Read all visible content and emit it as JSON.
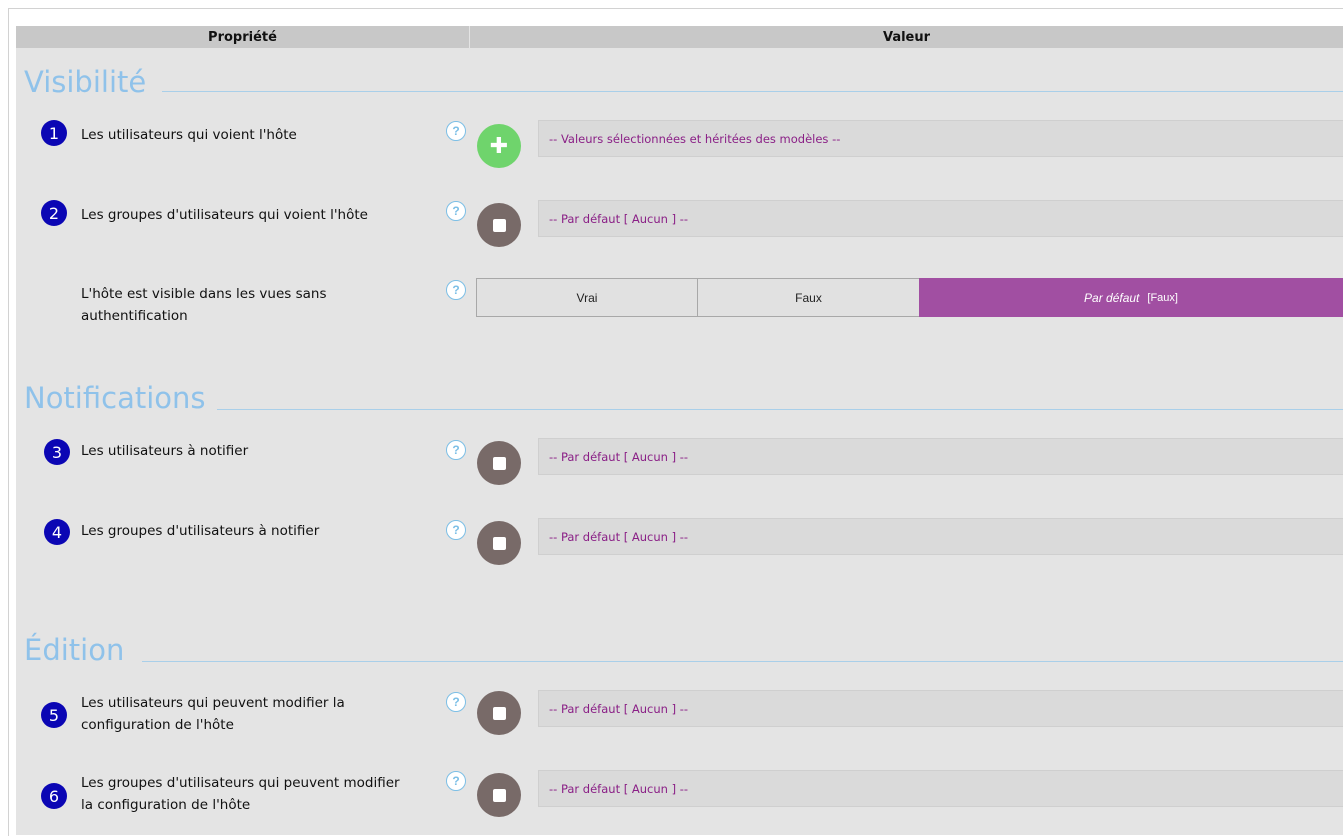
{
  "header": {
    "property_label": "Propriété",
    "value_label": "Valeur"
  },
  "sections": {
    "visibility": "Visibilité",
    "notifications": "Notifications",
    "edition": "Édition"
  },
  "help_glyph": "?",
  "rows": {
    "r1": {
      "number": "1",
      "label": "Les utilisateurs qui voient l'hôte",
      "value": "-- Valeurs sélectionnées et héritées des modèles --"
    },
    "r2": {
      "number": "2",
      "label": "Les groupes d'utilisateurs qui voient l'hôte",
      "value": "-- Par défaut [ Aucun ] --"
    },
    "r3": {
      "number": "3",
      "label": "Les utilisateurs à notifier",
      "value": "-- Par défaut [ Aucun ] --"
    },
    "r4": {
      "number": "4",
      "label": "Les groupes d'utilisateurs à notifier",
      "value": "-- Par défaut [ Aucun ] --"
    },
    "r5": {
      "number": "5",
      "label_line1": "Les utilisateurs qui peuvent modifier la",
      "label_line2": "configuration de l'hôte",
      "value": "-- Par défaut [ Aucun ] --"
    },
    "r6": {
      "number": "6",
      "label_line1": "Les groupes d'utilisateurs qui peuvent modifier",
      "label_line2": "la configuration de l'hôte",
      "value": "-- Par défaut [ Aucun ] --"
    }
  },
  "visible_unauth": {
    "label_line1": "L'hôte est visible dans les vues sans",
    "label_line2": "authentification",
    "options": {
      "true": "Vrai",
      "false": "Faux",
      "default": "Par défaut",
      "default_value": "[Faux]"
    },
    "selected": "default"
  },
  "icons": {
    "add_button": "plus-icon",
    "unset_button": "square-icon",
    "help": "question-icon"
  },
  "colors": {
    "section_title": "#8fc2ea",
    "number_badge": "#0b06b4",
    "add_button": "#6fd46c",
    "unset_button": "#786a68",
    "value_text": "#8a1f86",
    "selected_choice": "#a14fa2"
  }
}
